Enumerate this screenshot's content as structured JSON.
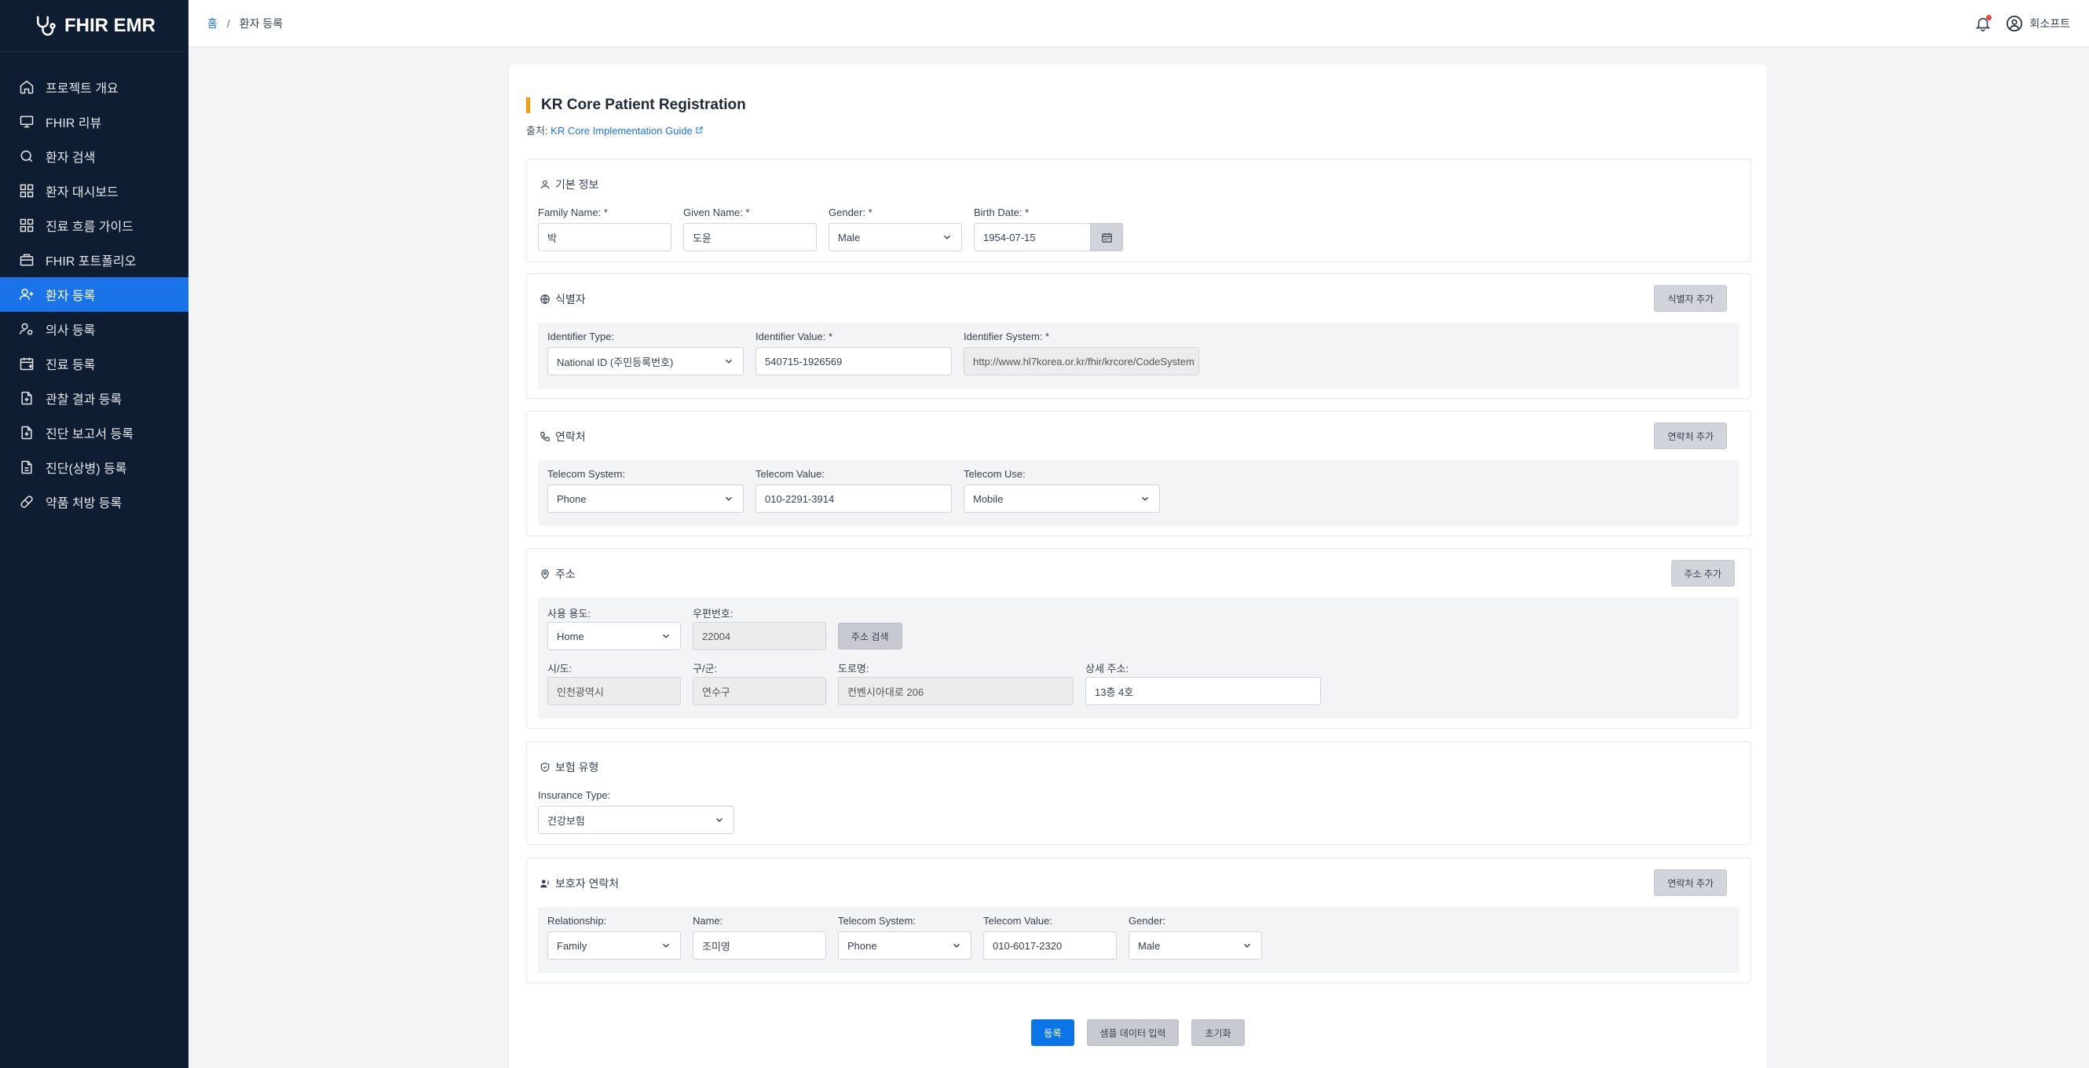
{
  "app": {
    "title": "FHIR EMR"
  },
  "sidebar": {
    "items": [
      {
        "label": "프로젝트 개요",
        "icon": "home-icon"
      },
      {
        "label": "FHIR 리뷰",
        "icon": "monitor-icon"
      },
      {
        "label": "환자 검색",
        "icon": "search-icon"
      },
      {
        "label": "환자 대시보드",
        "icon": "grid-icon"
      },
      {
        "label": "진료 흐름 가이드",
        "icon": "grid-icon"
      },
      {
        "label": "FHIR 포트폴리오",
        "icon": "briefcase-icon"
      },
      {
        "label": "환자 등록",
        "icon": "user-plus-icon",
        "active": true
      },
      {
        "label": "의사 등록",
        "icon": "user-gear-icon"
      },
      {
        "label": "진료 등록",
        "icon": "calendar-plus-icon"
      },
      {
        "label": "관찰 결과 등록",
        "icon": "file-plus-icon"
      },
      {
        "label": "진단 보고서 등록",
        "icon": "file-plus-icon"
      },
      {
        "label": "진단(상병) 등록",
        "icon": "document-icon"
      },
      {
        "label": "약품 처방 등록",
        "icon": "pill-icon"
      }
    ]
  },
  "topbar": {
    "breadcrumb_home": "홈",
    "breadcrumb_sep": "/",
    "breadcrumb_current": "환자 등록",
    "user_name": "회소프트"
  },
  "page": {
    "title": "KR Core Patient Registration",
    "source_prefix": "출처:",
    "source_link": "KR Core Implementation Guide"
  },
  "basic": {
    "title": "기본 정보",
    "family_label": "Family Name: *",
    "family_value": "박",
    "given_label": "Given Name: *",
    "given_value": "도윤",
    "gender_label": "Gender: *",
    "gender_value": "Male",
    "birth_label": "Birth Date: *",
    "birth_value": "1954-07-15"
  },
  "identifier": {
    "title": "식별자",
    "add_button": "식별자 추가",
    "type_label": "Identifier Type:",
    "type_value": "National ID (주민등록번호)",
    "value_label": "Identifier Value: *",
    "value_value": "540715-1926569",
    "system_label": "Identifier System: *",
    "system_value": "http://www.hl7korea.or.kr/fhir/krcore/CodeSystem"
  },
  "contact": {
    "title": "연락처",
    "add_button": "연락처 추가",
    "system_label": "Telecom System:",
    "system_value": "Phone",
    "value_label": "Telecom Value:",
    "value_value": "010-2291-3914",
    "use_label": "Telecom Use:",
    "use_value": "Mobile"
  },
  "address": {
    "title": "주소",
    "add_button": "주소 추가",
    "use_label": "사용 용도:",
    "use_value": "Home",
    "postal_label": "우편번호:",
    "postal_value": "22004",
    "search_button": "주소 검색",
    "city_label": "시/도:",
    "city_value": "인천광역시",
    "district_label": "구/군:",
    "district_value": "연수구",
    "road_label": "도로명:",
    "road_value": "컨벤시아대로 206",
    "detail_label": "상세 주소:",
    "detail_value": "13층 4호"
  },
  "insurance": {
    "title": "보험 유형",
    "type_label": "Insurance Type:",
    "type_value": "건강보험"
  },
  "guardian": {
    "title": "보호자 연락처",
    "add_button": "연락처 추가",
    "relationship_label": "Relationship:",
    "relationship_value": "Family",
    "name_label": "Name:",
    "name_value": "조미영",
    "system_label": "Telecom System:",
    "system_value": "Phone",
    "value_label": "Telecom Value:",
    "value_value": "010-6017-2320",
    "gender_label": "Gender:",
    "gender_value": "Male"
  },
  "actions": {
    "submit": "등록",
    "sample": "샘플 데이터 입력",
    "reset": "초기화"
  },
  "colors": {
    "sidebar_bg": "#0f1d33",
    "accent": "#1a73e8",
    "title_bar": "#f59e0b"
  }
}
